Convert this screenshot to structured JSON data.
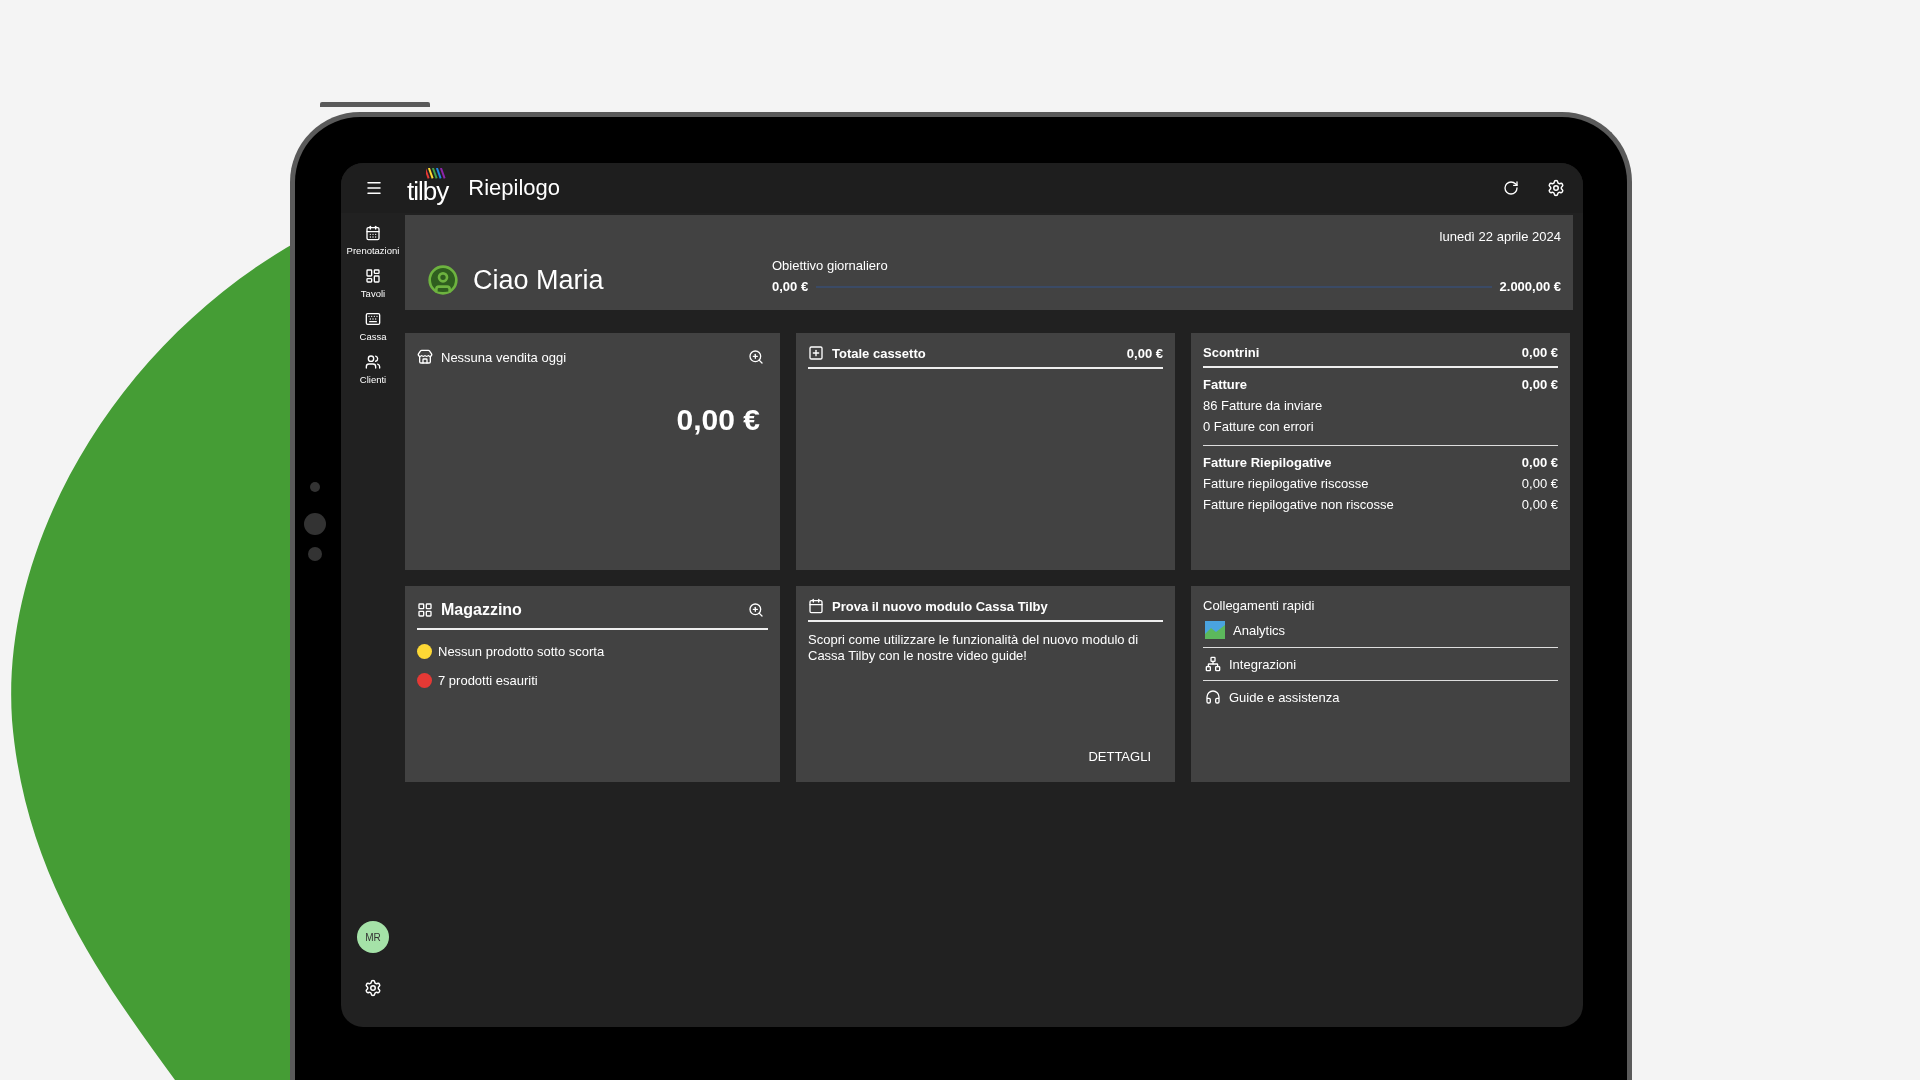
{
  "header": {
    "logo": "tilby",
    "title": "Riepilogo"
  },
  "sidebar": {
    "items": [
      {
        "label": "Prenotazioni"
      },
      {
        "label": "Tavoli"
      },
      {
        "label": "Cassa"
      },
      {
        "label": "Clienti"
      }
    ],
    "user_initials": "MR"
  },
  "summary": {
    "date": "lunedì 22 aprile 2024",
    "greeting": "Ciao Maria",
    "goal": {
      "label": "Obiettivo giornaliero",
      "start": "0,00 €",
      "end": "2.000,00 €",
      "level": 0
    }
  },
  "sales_card": {
    "title": "Nessuna vendita oggi",
    "total": "0,00 €"
  },
  "drawer_card": {
    "title": "Totale cassetto",
    "amount": "0,00 €"
  },
  "receipts_card": {
    "header": {
      "label": "Scontrini",
      "amount": "0,00 €"
    },
    "groups": [
      {
        "title": "Fatture",
        "amount": "0,00 €",
        "lines": [
          {
            "label": "86 Fatture da inviare"
          },
          {
            "label": "0 Fatture con errori"
          }
        ]
      },
      {
        "title": "Fatture Riepilogative",
        "amount": "0,00 €",
        "lines": [
          {
            "label": "Fatture riepilogative riscosse",
            "amount": "0,00 €"
          },
          {
            "label": "Fatture riepilogative non riscosse",
            "amount": "0,00 €"
          }
        ]
      }
    ]
  },
  "stock_card": {
    "title": "Magazzino",
    "items": [
      {
        "label": "Nessun prodotto sotto scorta",
        "color": "#fdd835"
      },
      {
        "label": "7 prodotti esauriti",
        "color": "#e53935"
      }
    ]
  },
  "promo_card": {
    "title": "Prova il nuovo modulo Cassa Tilby",
    "text": "Scopri come utilizzare le funzionalità del nuovo modulo di Cassa Tilby con le nostre video guide!",
    "button": "DETTAGLI"
  },
  "links_card": {
    "title": "Collegamenti rapidi",
    "links": [
      {
        "label": "Analytics"
      },
      {
        "label": "Integrazioni"
      },
      {
        "label": "Guide e assistenza"
      }
    ]
  }
}
